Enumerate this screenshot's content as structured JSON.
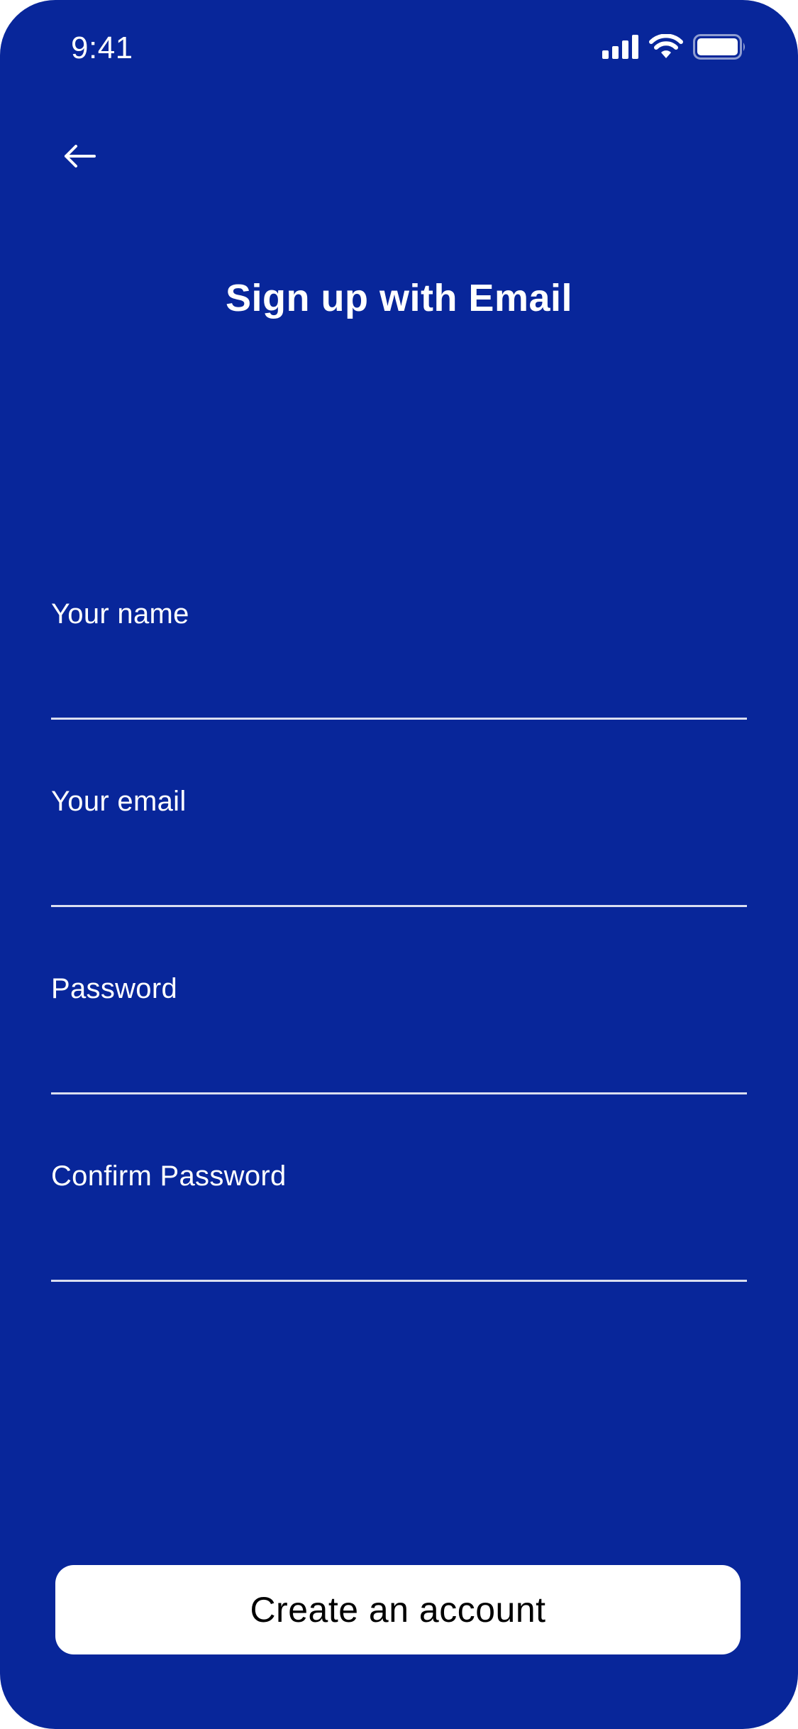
{
  "status_bar": {
    "time": "9:41",
    "icons": [
      "cellular-signal-icon",
      "wifi-icon",
      "battery-icon"
    ]
  },
  "header": {
    "back_icon": "arrow-left-icon",
    "title": "Sign up with Email"
  },
  "form": {
    "name": {
      "label": "Your name",
      "value": ""
    },
    "email": {
      "label": "Your email",
      "value": ""
    },
    "password": {
      "label": "Password",
      "value": ""
    },
    "confirm_password": {
      "label": "Confirm Password",
      "value": ""
    }
  },
  "actions": {
    "create_account_label": "Create an account"
  },
  "colors": {
    "background": "#08269A",
    "foreground": "#FFFFFF",
    "button_background": "#FFFFFF",
    "button_text": "#000000"
  }
}
